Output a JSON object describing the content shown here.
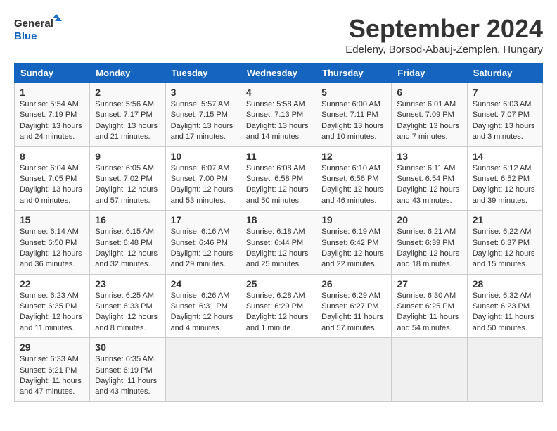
{
  "header": {
    "logo_line1": "General",
    "logo_line2": "Blue",
    "month": "September 2024",
    "location": "Edeleny, Borsod-Abauj-Zemplen, Hungary"
  },
  "days_of_week": [
    "Sunday",
    "Monday",
    "Tuesday",
    "Wednesday",
    "Thursday",
    "Friday",
    "Saturday"
  ],
  "weeks": [
    [
      {
        "day": "1",
        "text": "Sunrise: 5:54 AM\nSunset: 7:19 PM\nDaylight: 13 hours\nand 24 minutes."
      },
      {
        "day": "2",
        "text": "Sunrise: 5:56 AM\nSunset: 7:17 PM\nDaylight: 13 hours\nand 21 minutes."
      },
      {
        "day": "3",
        "text": "Sunrise: 5:57 AM\nSunset: 7:15 PM\nDaylight: 13 hours\nand 17 minutes."
      },
      {
        "day": "4",
        "text": "Sunrise: 5:58 AM\nSunset: 7:13 PM\nDaylight: 13 hours\nand 14 minutes."
      },
      {
        "day": "5",
        "text": "Sunrise: 6:00 AM\nSunset: 7:11 PM\nDaylight: 13 hours\nand 10 minutes."
      },
      {
        "day": "6",
        "text": "Sunrise: 6:01 AM\nSunset: 7:09 PM\nDaylight: 13 hours\nand 7 minutes."
      },
      {
        "day": "7",
        "text": "Sunrise: 6:03 AM\nSunset: 7:07 PM\nDaylight: 13 hours\nand 3 minutes."
      }
    ],
    [
      {
        "day": "8",
        "text": "Sunrise: 6:04 AM\nSunset: 7:05 PM\nDaylight: 13 hours\nand 0 minutes."
      },
      {
        "day": "9",
        "text": "Sunrise: 6:05 AM\nSunset: 7:02 PM\nDaylight: 12 hours\nand 57 minutes."
      },
      {
        "day": "10",
        "text": "Sunrise: 6:07 AM\nSunset: 7:00 PM\nDaylight: 12 hours\nand 53 minutes."
      },
      {
        "day": "11",
        "text": "Sunrise: 6:08 AM\nSunset: 6:58 PM\nDaylight: 12 hours\nand 50 minutes."
      },
      {
        "day": "12",
        "text": "Sunrise: 6:10 AM\nSunset: 6:56 PM\nDaylight: 12 hours\nand 46 minutes."
      },
      {
        "day": "13",
        "text": "Sunrise: 6:11 AM\nSunset: 6:54 PM\nDaylight: 12 hours\nand 43 minutes."
      },
      {
        "day": "14",
        "text": "Sunrise: 6:12 AM\nSunset: 6:52 PM\nDaylight: 12 hours\nand 39 minutes."
      }
    ],
    [
      {
        "day": "15",
        "text": "Sunrise: 6:14 AM\nSunset: 6:50 PM\nDaylight: 12 hours\nand 36 minutes."
      },
      {
        "day": "16",
        "text": "Sunrise: 6:15 AM\nSunset: 6:48 PM\nDaylight: 12 hours\nand 32 minutes."
      },
      {
        "day": "17",
        "text": "Sunrise: 6:16 AM\nSunset: 6:46 PM\nDaylight: 12 hours\nand 29 minutes."
      },
      {
        "day": "18",
        "text": "Sunrise: 6:18 AM\nSunset: 6:44 PM\nDaylight: 12 hours\nand 25 minutes."
      },
      {
        "day": "19",
        "text": "Sunrise: 6:19 AM\nSunset: 6:42 PM\nDaylight: 12 hours\nand 22 minutes."
      },
      {
        "day": "20",
        "text": "Sunrise: 6:21 AM\nSunset: 6:39 PM\nDaylight: 12 hours\nand 18 minutes."
      },
      {
        "day": "21",
        "text": "Sunrise: 6:22 AM\nSunset: 6:37 PM\nDaylight: 12 hours\nand 15 minutes."
      }
    ],
    [
      {
        "day": "22",
        "text": "Sunrise: 6:23 AM\nSunset: 6:35 PM\nDaylight: 12 hours\nand 11 minutes."
      },
      {
        "day": "23",
        "text": "Sunrise: 6:25 AM\nSunset: 6:33 PM\nDaylight: 12 hours\nand 8 minutes."
      },
      {
        "day": "24",
        "text": "Sunrise: 6:26 AM\nSunset: 6:31 PM\nDaylight: 12 hours\nand 4 minutes."
      },
      {
        "day": "25",
        "text": "Sunrise: 6:28 AM\nSunset: 6:29 PM\nDaylight: 12 hours\nand 1 minute."
      },
      {
        "day": "26",
        "text": "Sunrise: 6:29 AM\nSunset: 6:27 PM\nDaylight: 11 hours\nand 57 minutes."
      },
      {
        "day": "27",
        "text": "Sunrise: 6:30 AM\nSunset: 6:25 PM\nDaylight: 11 hours\nand 54 minutes."
      },
      {
        "day": "28",
        "text": "Sunrise: 6:32 AM\nSunset: 6:23 PM\nDaylight: 11 hours\nand 50 minutes."
      }
    ],
    [
      {
        "day": "29",
        "text": "Sunrise: 6:33 AM\nSunset: 6:21 PM\nDaylight: 11 hours\nand 47 minutes."
      },
      {
        "day": "30",
        "text": "Sunrise: 6:35 AM\nSunset: 6:19 PM\nDaylight: 11 hours\nand 43 minutes."
      },
      {
        "day": "",
        "text": ""
      },
      {
        "day": "",
        "text": ""
      },
      {
        "day": "",
        "text": ""
      },
      {
        "day": "",
        "text": ""
      },
      {
        "day": "",
        "text": ""
      }
    ]
  ]
}
